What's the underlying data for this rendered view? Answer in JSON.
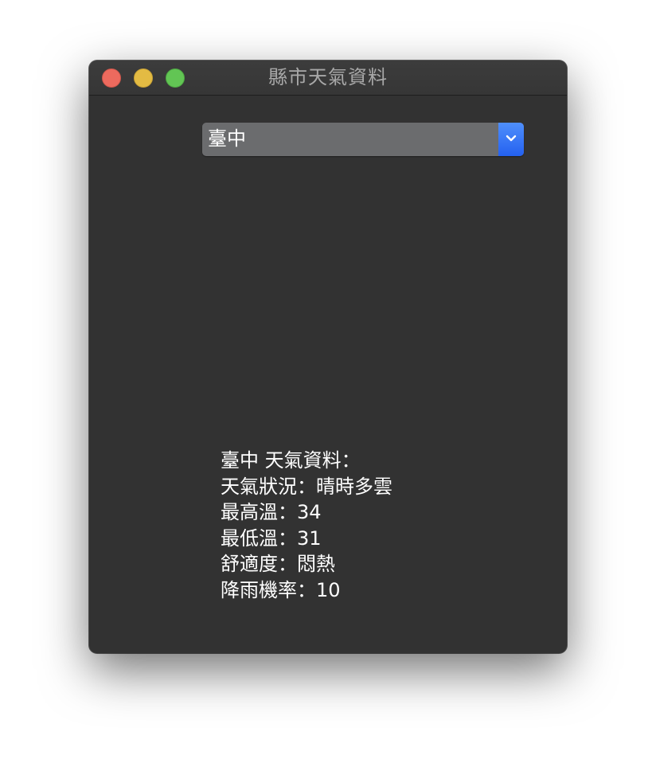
{
  "window": {
    "title": "縣市天氣資料"
  },
  "city_select": {
    "selected": "臺中",
    "icon": "chevron-down-icon",
    "accent_color": "#2f6ff5"
  },
  "weather_info": {
    "heading": "臺中 天氣資料：",
    "condition": "天氣狀況：晴時多雲",
    "max_temp": "最高溫：34",
    "min_temp": "最低溫：31",
    "comfort": "舒適度：悶熱",
    "rain_chance": "降雨機率：10"
  },
  "traffic_lights": {
    "close_color": "#ed6a5e",
    "minimize_color": "#e3bb43",
    "zoom_color": "#62c554"
  }
}
